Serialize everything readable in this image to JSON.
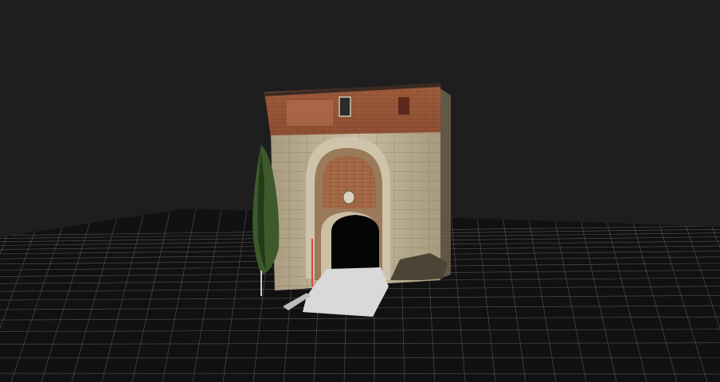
{
  "viewer": {
    "background_color": "#1e1e1e",
    "grid_color": "#8a8a8a",
    "ground_color": "#111111"
  },
  "model": {
    "subject": "stone-gate-point-cloud",
    "colors": {
      "brick": "#9a5a3a",
      "brick_dark": "#7b4128",
      "stone": "#b9ab8f",
      "stone_light": "#d2c7b0",
      "stone_dark": "#8d7f66",
      "archway": "#0a0a0a",
      "floor": "#d9d9d9",
      "cypress": "#3e5a2a",
      "cypress_dark": "#243a18"
    }
  }
}
